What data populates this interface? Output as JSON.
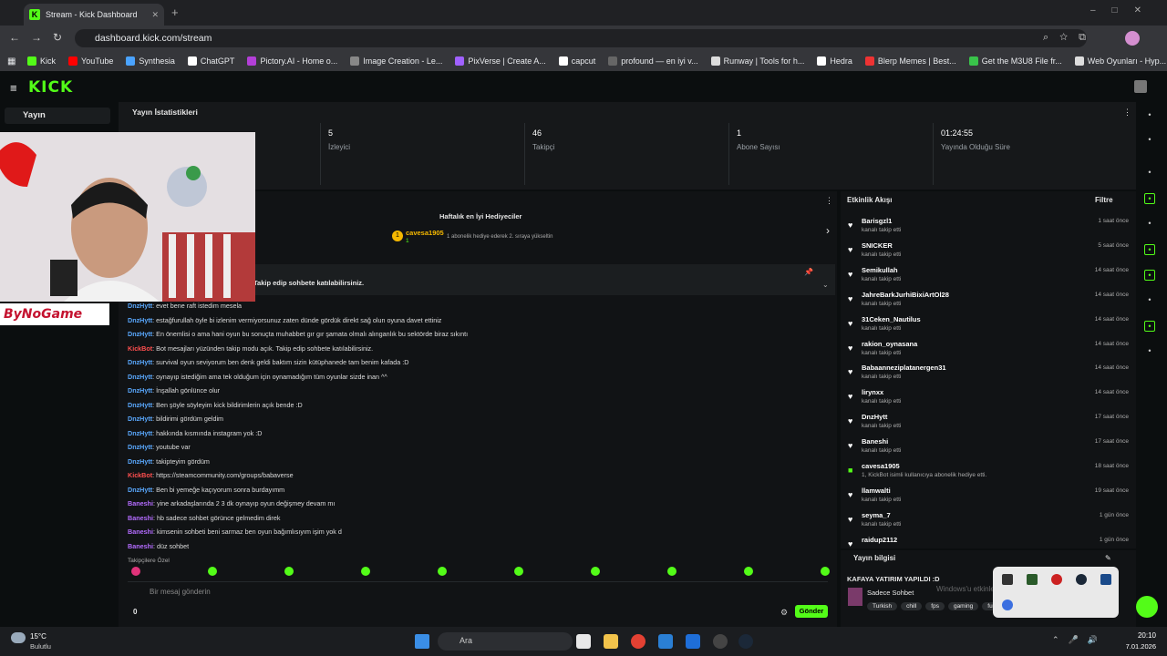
{
  "browser": {
    "tab_title": "Stream - Kick Dashboard",
    "url": "dashboard.kick.com/stream",
    "bookmarks": [
      "Kick",
      "YouTube",
      "Synthesia",
      "ChatGPT",
      "Pictory.AI - Home o...",
      "Image Creation - Le...",
      "PixVerse | Create A...",
      "capcut",
      "profound — en iyi v...",
      "Runway | Tools for h...",
      "Hedra",
      "Blerp Memes | Best...",
      "Get the M3U8 File fr...",
      "Web Oyunları - Hyp..."
    ]
  },
  "kick": {
    "logo": "KICK",
    "sidebar_item": "Yayın",
    "stats_title": "Yayın İstatistikleri",
    "stats": [
      {
        "value": "5",
        "label": "İzleyici"
      },
      {
        "value": "46",
        "label": "Takipçi"
      },
      {
        "value": "1",
        "label": "Abone Sayısı"
      },
      {
        "value": "01:24:55",
        "label": "Yayında Olduğu Süre"
      }
    ],
    "gifters": {
      "title": "Haftalık en İyi Hediyeciler",
      "name": "cavesa1905",
      "count": "1",
      "note": "1 abonelik hediye ederek 2. sıraya yükseltin"
    },
    "pinned": "Takip edip sohbete katılabilirsiniz.",
    "chat": [
      {
        "user": "DnzHytt",
        "cls": "dz",
        "text": ": evet bene raft istedim mesela"
      },
      {
        "user": "DnzHytt",
        "cls": "dz",
        "text": ": estağfurullah öyle bi izlenim vermiyorsunuz zaten dünde gördük direkt sağ olun oyuna davet ettiniz"
      },
      {
        "user": "DnzHytt",
        "cls": "dz",
        "text": ": En önemlisi o ama hani oyun bu sonuçta muhabbet gır gır şamata olmalı alınganlık bu sektörde biraz sıkıntı"
      },
      {
        "user": "KickBot",
        "cls": "kb",
        "text": ": Bot mesajları yüzünden takip modu açık. Takip edip sohbete katılabilirsiniz."
      },
      {
        "user": "DnzHytt",
        "cls": "dz",
        "text": ": survival oyun seviyorum ben denk geldi baktım sizin kütüphanede tam benim kafada :D"
      },
      {
        "user": "DnzHytt",
        "cls": "dz",
        "text": ": oynayıp istediğim ama tek olduğum için oynamadığım tüm oyunlar sizde inan ^^"
      },
      {
        "user": "DnzHytt",
        "cls": "dz",
        "text": ": İnşallah gönlünce olur"
      },
      {
        "user": "DnzHytt",
        "cls": "dz",
        "text": ": Ben şöyle söyleyim kick bildirimlerin açık bende :D"
      },
      {
        "user": "DnzHytt",
        "cls": "dz",
        "text": ": bildirimi gördüm geldim"
      },
      {
        "user": "DnzHytt",
        "cls": "dz",
        "text": ": hakkında kısmında instagram yok :D"
      },
      {
        "user": "DnzHytt",
        "cls": "dz",
        "text": ": youtube var"
      },
      {
        "user": "DnzHytt",
        "cls": "dz",
        "text": ": takipteyim gördüm"
      },
      {
        "user": "KickBot",
        "cls": "kb",
        "text": ": https://steamcommunity.com/groups/babaverse"
      },
      {
        "user": "DnzHytt",
        "cls": "dz",
        "text": ": Ben bi yemeğe kaçıyorum sonra burdayımm"
      },
      {
        "user": "Baneshi",
        "cls": "bn",
        "text": ": yine arkadaşlarında 2 3 dk oynayıp oyun değişmey devam mı"
      },
      {
        "user": "Baneshi",
        "cls": "bn",
        "text": ": hb sadece sohbet görünce gelmedim direk"
      },
      {
        "user": "Baneshi",
        "cls": "bn",
        "text": ": kimsenin sohbeti beni sarmaz ben oyun bağımlısıyım işim yok d"
      },
      {
        "user": "Baneshi",
        "cls": "bn",
        "text": ": düz sohbet"
      }
    ],
    "followers_only": "Takipçilere Özel",
    "input_placeholder": "Bir mesaj gönderin",
    "send_label": "Gönder",
    "viewer_count_small": "0",
    "activity_title": "Etkinlik Akışı",
    "filter_label": "Filtre",
    "activity": [
      {
        "name": "Barisgzl1",
        "sub": "kanalı takip etti",
        "time": "1 saat önce"
      },
      {
        "name": "SNICKER",
        "sub": "kanalı takip etti",
        "time": "5 saat önce"
      },
      {
        "name": "Semikullah",
        "sub": "kanalı takip etti",
        "time": "14 saat önce"
      },
      {
        "name": "JahreBarkJurhiBixiArtOl28",
        "sub": "kanalı takip etti",
        "time": "14 saat önce"
      },
      {
        "name": "31Ceken_Nautilus",
        "sub": "kanalı takip etti",
        "time": "14 saat önce"
      },
      {
        "name": "rakion_oynasana",
        "sub": "kanalı takip etti",
        "time": "14 saat önce"
      },
      {
        "name": "Babaanneziplatanergen31",
        "sub": "kanalı takip etti",
        "time": "14 saat önce"
      },
      {
        "name": "lirynxx",
        "sub": "kanalı takip etti",
        "time": "14 saat önce"
      },
      {
        "name": "DnzHytt",
        "sub": "kanalı takip etti",
        "time": "17 saat önce"
      },
      {
        "name": "Baneshi",
        "sub": "kanalı takip etti",
        "time": "17 saat önce"
      },
      {
        "name": "cavesa1905",
        "sub": "1, KickBot isimli kullanıcıya abonelik hediye etti.",
        "time": "18 saat önce"
      },
      {
        "name": "llamwalti",
        "sub": "kanalı takip etti",
        "time": "19 saat önce"
      },
      {
        "name": "seyma_7",
        "sub": "kanalı takip etti",
        "time": "1 gün önce"
      },
      {
        "name": "raidup2112",
        "sub": "",
        "time": "1 gün önce"
      }
    ],
    "stream_info_title": "Yayın bilgisi",
    "stream_title": "KAFAYA YATIRIM YAPILDI :D",
    "category": "Sadece Sohbet",
    "tags": [
      "Turkish",
      "chill",
      "fps",
      "gaming",
      "funny"
    ],
    "overlay_brand": "ByNoGame",
    "windows_watermark": "Windows'u etkinleştirmek için Ayarlar'a gidin."
  },
  "taskbar": {
    "weather_temp": "15°C",
    "weather_desc": "Bulutlu",
    "search_label": "Ara",
    "time": "20:10",
    "date": "7.01.2026"
  }
}
